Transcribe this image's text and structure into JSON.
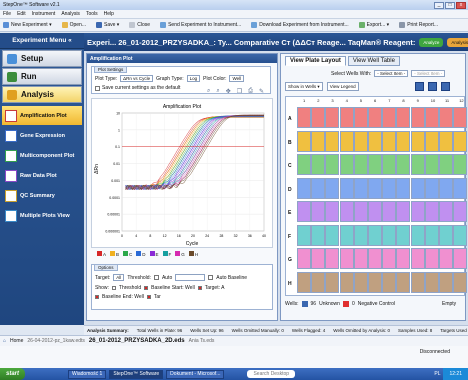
{
  "window": {
    "title": "StepOne™ Software v2.1"
  },
  "menu": [
    "File",
    "Edit",
    "Instrument",
    "Analysis",
    "Tools",
    "Help"
  ],
  "toolbar": [
    {
      "label": "New Experiment ▾",
      "icon": "new-icon"
    },
    {
      "label": "Open...",
      "icon": "folder-icon"
    },
    {
      "label": "Save ▾",
      "icon": "save-icon"
    },
    {
      "label": "Close",
      "icon": "close-icon"
    },
    {
      "label": "Send Experiment to Instrument...",
      "icon": "send-icon"
    },
    {
      "label": "Download Experiment from Instrument...",
      "icon": "download-icon"
    },
    {
      "label": "Export... ▾",
      "icon": "export-icon"
    },
    {
      "label": "Print Report...",
      "icon": "print-icon"
    }
  ],
  "nav": {
    "title": "Experiment Menu «",
    "sections": [
      {
        "label": "Setup",
        "color": "#4a90d9"
      },
      {
        "label": "Run",
        "color": "#3c8d3c"
      },
      {
        "label": "Analysis",
        "color": "#e0a020"
      }
    ],
    "analysis_items": [
      {
        "label": "Amplification Plot",
        "color": "#c83a3a"
      },
      {
        "label": "Gene Expression",
        "color": "#3a6cc8"
      },
      {
        "label": "Multicomponent Plot",
        "color": "#33a050"
      },
      {
        "label": "Raw Data Plot",
        "color": "#8a4ac8"
      },
      {
        "label": "QC Summary",
        "color": "#c8a030"
      },
      {
        "label": "Multiple Plots View",
        "color": "#3a8ac8"
      }
    ]
  },
  "header": {
    "text": "Experi... 26_01-2012_PRZYSADKA_: Ty... Comparative Cт (ΔΔCт Reage... TaqMan® Reagent:",
    "analyze": "Analyze",
    "settings": "Analysis Settings"
  },
  "amp": {
    "panel_title": "Amplification Plot",
    "settings_tab": "Plot Settings",
    "plot_type_label": "Plot Type:",
    "plot_type": "ΔRn vs Cycle",
    "graph_type_label": "Graph Type:",
    "graph_type": "Log",
    "plot_color_label": "Plot Color:",
    "plot_color": "Well",
    "save_default": "Save current settings as the default",
    "chart_title": "Amplification Plot",
    "y_label": "ΔRn",
    "x_label": "Cycle",
    "options_title": "Options",
    "target_label": "Target:",
    "target": "All",
    "threshold_label": "Threshold:",
    "auto_label": "Auto",
    "auto_baseline": "Auto Baseline",
    "show_label": "Show:",
    "show_items": [
      "Threshold",
      "Baseline Start: Well",
      "Target: A",
      "Baseline End: Well",
      "Tar"
    ]
  },
  "chart_data": {
    "type": "line",
    "title": "Amplification Plot",
    "xlabel": "Cycle",
    "ylabel": "ΔRn",
    "y_scale": "log",
    "y_ticks": [
      "10",
      "1",
      "0.1",
      "0.01",
      "0.001",
      "0.0001",
      "0.00001",
      "0.000001"
    ],
    "x_ticks": [
      "0",
      "4",
      "8",
      "12",
      "16",
      "20",
      "24",
      "28",
      "32",
      "36",
      "40"
    ],
    "xlim": [
      0,
      40
    ],
    "ylim": [
      1e-06,
      10
    ],
    "legend": [
      "A",
      "B",
      "C",
      "D",
      "E",
      "F",
      "G",
      "H"
    ],
    "legend_colors": [
      "#d62828",
      "#f0b020",
      "#2aa84a",
      "#2a6ad6",
      "#8a2ad6",
      "#16a0a0",
      "#d62ab0",
      "#6a4a2a"
    ],
    "series": [
      {
        "color": "#d62828",
        "ct": 21
      },
      {
        "color": "#f0b020",
        "ct": 22
      },
      {
        "color": "#2aa84a",
        "ct": 23
      },
      {
        "color": "#2a6ad6",
        "ct": 24
      },
      {
        "color": "#8a2ad6",
        "ct": 25
      },
      {
        "color": "#16a0a0",
        "ct": 26
      },
      {
        "color": "#d62ab0",
        "ct": 27
      },
      {
        "color": "#6a4a2a",
        "ct": 28
      }
    ]
  },
  "plate": {
    "tabs": [
      "View Plate Layout",
      "View Well Table"
    ],
    "select_wells_label": "Select Wells With:",
    "select_wells": "- Select Item -",
    "select_item": "- Select Item -",
    "show_in_wells": "Show in Wells ▾",
    "view_legend": "View Legend",
    "cols": [
      "1",
      "2",
      "3",
      "4",
      "5",
      "6",
      "7",
      "8",
      "9",
      "10",
      "11",
      "12"
    ],
    "rows": [
      "A",
      "B",
      "C",
      "D",
      "E",
      "F",
      "G",
      "H"
    ],
    "wells_label": "Wells:",
    "unknown_count": "96",
    "unknown": "Unknown",
    "neg_count": "0",
    "neg": "Negative Control",
    "empty": "Empty",
    "well_colors": [
      "#f08080",
      "#f0c040",
      "#80d080",
      "#80a8f0",
      "#c090f0",
      "#70d0d0",
      "#f090d0",
      "#c0a080"
    ]
  },
  "summary": {
    "title": "Analysis Summary:",
    "items": [
      "Total Wells in Plate: 96",
      "Wells Set Up: 96",
      "Wells Omitted Manually: 0",
      "Wells Flagged: 4",
      "Wells Omitted by Analysis: 0",
      "Samples Used: 8",
      "Targets Used"
    ]
  },
  "bottom": {
    "home": "Home",
    "tabs": [
      "26-04-2012-pz_1kaw.edts",
      "26_01-2012_PRZYSADKA_2D.eds",
      "Ania Ts.eds"
    ]
  },
  "status": "Disconnected",
  "taskbar": {
    "start": "start",
    "tasks": [
      "Wiadomość 1",
      "StepOne™ Software",
      "Dokument - Microsof..."
    ],
    "search": "Search Desktop",
    "lang": "PL",
    "time": "12:21"
  }
}
